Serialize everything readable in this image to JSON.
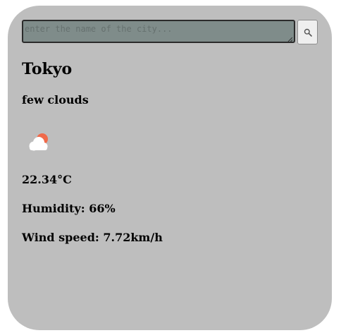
{
  "search": {
    "placeholder": "enter the name of the city...",
    "button_icon": "search-icon"
  },
  "weather": {
    "city": "Tokyo",
    "description": "few clouds",
    "icon": "few-clouds-icon",
    "temperature": "22.34°C",
    "humidity": "Humidity: 66%",
    "wind_speed": "Wind speed: 7.72km/h"
  },
  "colors": {
    "card_background": "#bebebe",
    "input_background": "#7f8c8a",
    "sun": "#f06a4a",
    "cloud": "#ffffff"
  }
}
